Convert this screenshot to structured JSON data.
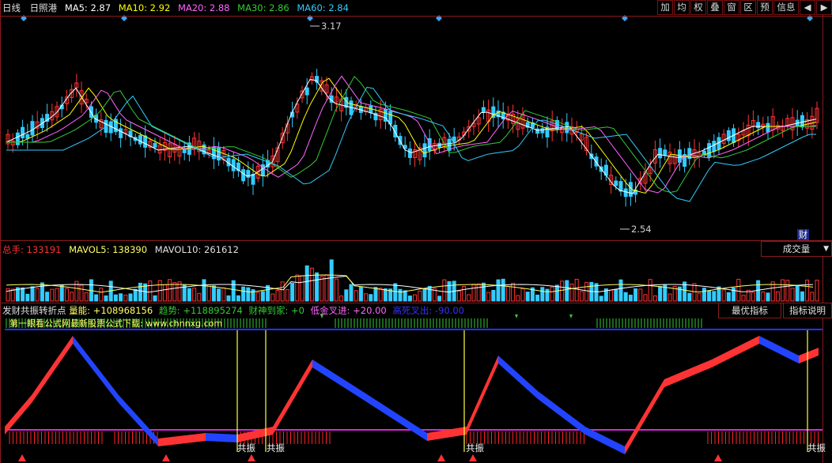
{
  "header": {
    "period": "日线",
    "stock": "日照港",
    "ma": [
      {
        "label": "MA5: 2.87",
        "color": "#ffffff"
      },
      {
        "label": "MA10: 2.92",
        "color": "#ffff00"
      },
      {
        "label": "MA20: 2.88",
        "color": "#ff66ff"
      },
      {
        "label": "MA30: 2.86",
        "color": "#33cc33"
      },
      {
        "label": "MA60: 2.84",
        "color": "#33ccff"
      }
    ]
  },
  "toolbar": [
    "加",
    "均",
    "权",
    "叠",
    "窗",
    "区",
    "预",
    "信息"
  ],
  "price_panel": {
    "high_label": "3.17",
    "low_label": "2.54",
    "cai_badge": "财"
  },
  "volume_panel": {
    "vol_label": "总手: ",
    "vol_value": "133191",
    "mavol5": "MAVOL5: 138390",
    "mavol10": "MAVOL10: 261612",
    "dropdown": "成交量"
  },
  "indicator_panel": {
    "name": "发财共振转折点",
    "items": [
      {
        "text": "量能: +108968156",
        "color": "#ffff66"
      },
      {
        "text": "趋势: +118895274",
        "color": "#33cc33"
      },
      {
        "text": "财神到家: +0",
        "color": "#33cc33"
      },
      {
        "text": "低金叉进: +20.00",
        "color": "#ff66ff"
      },
      {
        "text": "高死叉出: -90.00",
        "color": "#3333ff"
      }
    ],
    "watermark": "第一眼看公式网最新股票公式下载: www.chnnxg.com",
    "signal_label": "共振",
    "btn_best": "最优指标",
    "btn_help": "指标说明"
  },
  "colors": {
    "up": "#ff3333",
    "down": "#33ccff",
    "grid": "#8a1a1a"
  }
}
